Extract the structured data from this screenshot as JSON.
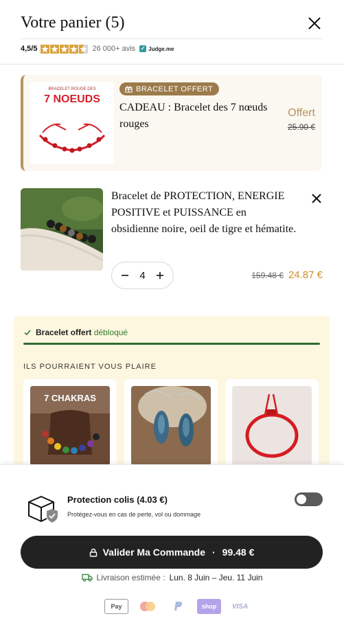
{
  "header": {
    "title": "Votre panier (5)",
    "rating": "4,5/5",
    "reviews": "26 000+ avis",
    "judgeme": "Judge.me"
  },
  "gift_item": {
    "badge": "BRACELET OFFERT",
    "name": "CADEAU : Bracelet des 7 nœuds rouges",
    "price_label": "Offert",
    "old_price": "25.90 €",
    "image_heading": "BRACELET ROUGE DES",
    "image_title": "7 NOEUDS"
  },
  "cart_item": {
    "name": "Bracelet de PROTECTION, ENERGIE POSITIVE et PUISSANCE en obsidienne noire, oeil de tigre et hématite.",
    "quantity": "4",
    "old_price": "159.48 €",
    "price": "24.87 €"
  },
  "upsell": {
    "unlock_bold": "Bracelet offert",
    "unlock_green": "débloqué",
    "progress": 1.0,
    "title": "ILS POURRAIENT VOUS PLAIRE",
    "products": [
      {
        "image_label": "7 CHAKRAS"
      },
      {
        "image_label": ""
      },
      {
        "image_label": ""
      }
    ]
  },
  "footer": {
    "protection_title": "Protection colis  (4.03 €)",
    "protection_sub": "Protégez-vous en cas de perte, vol ou dommage",
    "toggle_on": false,
    "checkout_label": "Valider Ma Commande",
    "checkout_sep": "·",
    "checkout_total": "99.48 €",
    "delivery_label": "Livraison estimée :",
    "delivery_dates": "Lun. 8 Juin – Jeu. 11 Juin",
    "payments": [
      "Apple Pay",
      "Mastercard",
      "PayPal",
      "shop",
      "VISA"
    ],
    "apple_pay_text": "Pay",
    "shop_text": "shop",
    "visa_text": "VISA"
  },
  "colors": {
    "accent_gold": "#b3925d",
    "price_orange": "#d08d24",
    "checkout_bg": "#222222",
    "upsell_bg": "#fef7df",
    "progress_green": "#2e6b2f"
  }
}
